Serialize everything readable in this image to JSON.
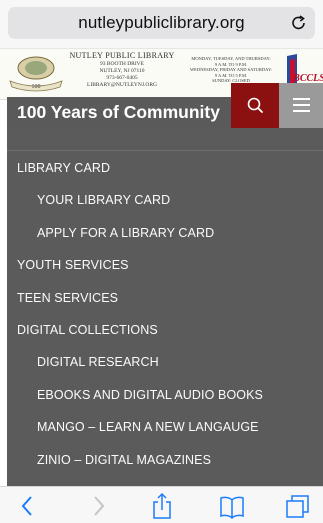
{
  "browser": {
    "url": "nutleypubliclibrary.org",
    "reload_icon": "reload-icon"
  },
  "banner": {
    "library_name": "NUTLEY PUBLIC LIBRARY",
    "address_line1": "93 BOOTH DRIVE",
    "address_line2": "NUTLEY, NJ 07110",
    "phone": "973-667-0405",
    "email": "LIBRARY@NUTLEYNJ.ORG",
    "seal_text": "100",
    "hours_line1": "MONDAY, TUESDAY, AND THURSDAY:",
    "hours_line2": "9 A.M. TO 9 P.M.",
    "hours_line3": "WEDNESDAY, FRIDAY AND SATURDAY:",
    "hours_line4": "9 A.M. TO 5 P.M.",
    "hours_line5": "SUNDAY: CLOSED",
    "partner_logo_text": "BCCLS"
  },
  "header": {
    "site_title": "100 Years of Community",
    "search_icon": "search-icon",
    "menu_icon": "hamburger-menu-icon",
    "colors": {
      "bar": "#5a5a5a",
      "search_bg": "#8b1010",
      "menu_bg": "#9a9a9a"
    }
  },
  "menu": {
    "items": [
      {
        "label": "Library Card",
        "level": 0
      },
      {
        "label": "Your Library Card",
        "level": 1
      },
      {
        "label": "Apply For A Library Card",
        "level": 1
      },
      {
        "label": "Youth Services",
        "level": 0
      },
      {
        "label": "Teen Services",
        "level": 0
      },
      {
        "label": "Digital Collections",
        "level": 0
      },
      {
        "label": "Digital Research",
        "level": 1
      },
      {
        "label": "eBooks and Digital Audio Books",
        "level": 1
      },
      {
        "label": "Mango – Learn a New Langauge",
        "level": 1
      },
      {
        "label": "Zinio – Digital Magazines",
        "level": 1
      }
    ]
  },
  "toolbar": {
    "back_icon": "back-chevron-icon",
    "forward_icon": "forward-chevron-icon",
    "share_icon": "share-icon",
    "bookmarks_icon": "bookmarks-icon",
    "tabs_icon": "tabs-icon",
    "accent": "#1a7cfa"
  }
}
